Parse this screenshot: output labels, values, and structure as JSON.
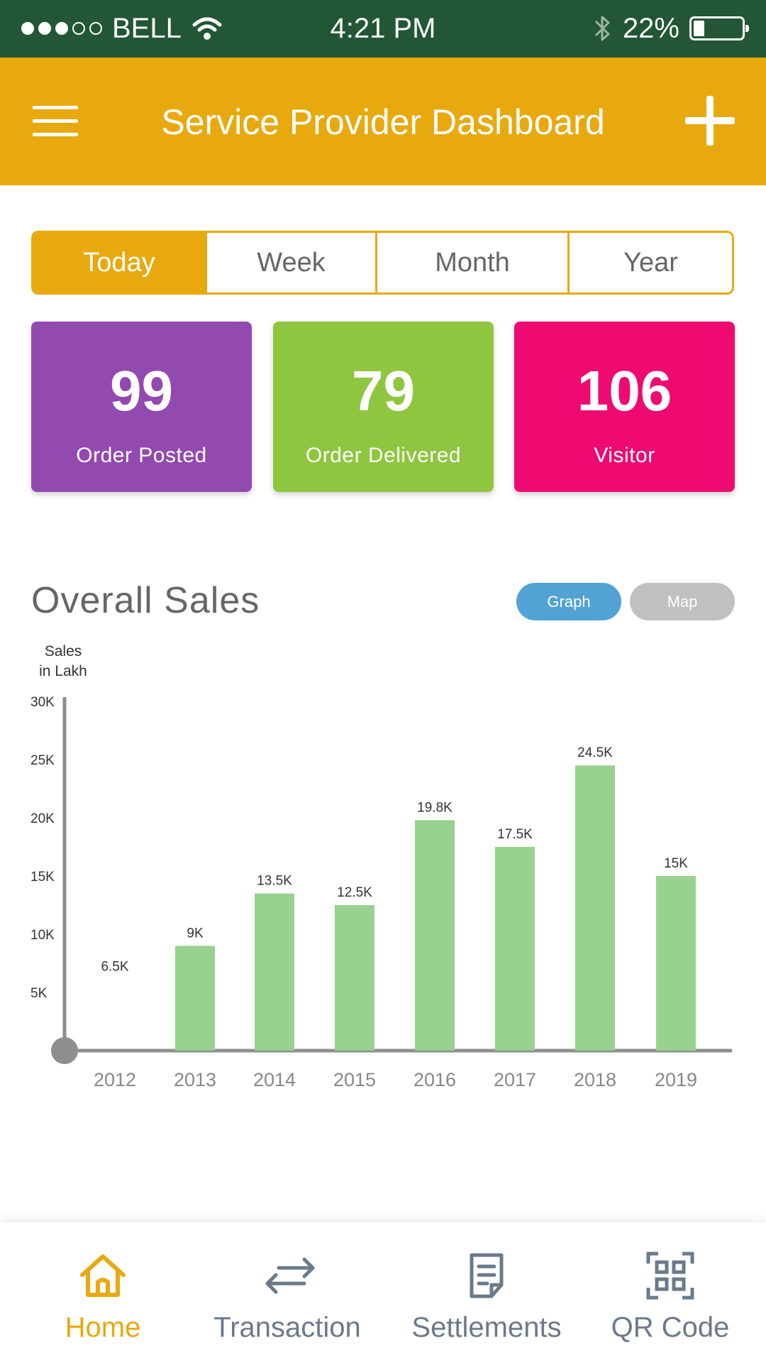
{
  "status_bar": {
    "carrier": "BELL",
    "time": "4:21 PM",
    "battery_percent": "22%",
    "battery_level": 0.22,
    "signal_bars_filled": 3,
    "signal_bars_total": 5,
    "icons": [
      "wifi-icon",
      "bluetooth-icon",
      "battery-icon"
    ]
  },
  "app_bar": {
    "title": "Service Provider Dashboard",
    "menu_icon": "hamburger-menu-icon",
    "add_icon": "plus-icon"
  },
  "period_tabs": [
    {
      "label": "Today",
      "active": true
    },
    {
      "label": "Week",
      "active": false
    },
    {
      "label": "Month",
      "active": false
    },
    {
      "label": "Year",
      "active": false
    }
  ],
  "stats": [
    {
      "value": "99",
      "label": "Order Posted",
      "color": "#9249B0"
    },
    {
      "value": "79",
      "label": "Order Delivered",
      "color": "#8EC63F"
    },
    {
      "value": "106",
      "label": "Visitor",
      "color": "#EE0A71"
    }
  ],
  "overall_sales": {
    "title": "Overall Sales",
    "toggle": {
      "graph_label": "Graph",
      "map_label": "Map",
      "selected": "Graph"
    }
  },
  "chart_data": {
    "type": "bar",
    "title": "",
    "ylabel_line1": "Sales",
    "ylabel_line2": "in Lakh",
    "xlabel": "",
    "categories": [
      "2012",
      "2013",
      "2014",
      "2015",
      "2016",
      "2017",
      "2018",
      "2019"
    ],
    "values": [
      0,
      9000,
      13500,
      12500,
      19800,
      17500,
      24500,
      15000
    ],
    "data_labels": [
      "6.5K",
      "9K",
      "13.5K",
      "12.5K",
      "19.8K",
      "17.5K",
      "24.5K",
      "15K"
    ],
    "yticks": [
      {
        "value": 5000,
        "label": "5K"
      },
      {
        "value": 10000,
        "label": "10K"
      },
      {
        "value": 15000,
        "label": "15K"
      },
      {
        "value": 20000,
        "label": "20K"
      },
      {
        "value": 25000,
        "label": "25K"
      },
      {
        "value": 30000,
        "label": "30K"
      }
    ],
    "ylim": [
      0,
      30000
    ],
    "bar_color": "#97D28F",
    "grid": false,
    "legend": "none"
  },
  "bottom_nav": [
    {
      "label": "Home",
      "icon": "home-icon",
      "active": true
    },
    {
      "label": "Transaction",
      "icon": "transfer-arrows-icon",
      "active": false
    },
    {
      "label": "Settlements",
      "icon": "document-icon",
      "active": false
    },
    {
      "label": "QR Code",
      "icon": "qr-code-icon",
      "active": false
    }
  ],
  "colors": {
    "status_bar": "#225634",
    "accent": "#E8A90F",
    "graph_toggle": "#52A3D4",
    "map_toggle": "#C0C0C0",
    "nav_inactive": "#6B7A8A"
  }
}
